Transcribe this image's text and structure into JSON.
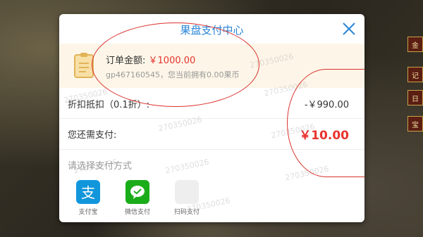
{
  "modal": {
    "title": "果盘支付中心",
    "order": {
      "amount_label": "订单金额:",
      "amount_value": "￥1000.00",
      "account_text": "gp467160545，您当前拥有0.00果币"
    },
    "discount": {
      "label": "折扣抵扣（0.1折）:",
      "value": "-￥990.00"
    },
    "due": {
      "label": "您还需支付:",
      "value": "￥10.00"
    },
    "method_title": "请选择支付方式",
    "methods": [
      {
        "label": "支付宝",
        "icon": "alipay-icon",
        "color": "#1296db"
      },
      {
        "label": "微信支付",
        "icon": "wechat-pay-icon",
        "color": "#1aad19"
      },
      {
        "label": "扫码支付",
        "icon": "qr-scan-icon",
        "color": "#eeeeee"
      }
    ]
  },
  "side_tabs": [
    "金",
    "记",
    "日",
    "宝"
  ],
  "watermark": "270350026",
  "colors": {
    "accent": "#2a86d8",
    "price": "#e8332e",
    "order_bg": "#fdf6e8"
  }
}
